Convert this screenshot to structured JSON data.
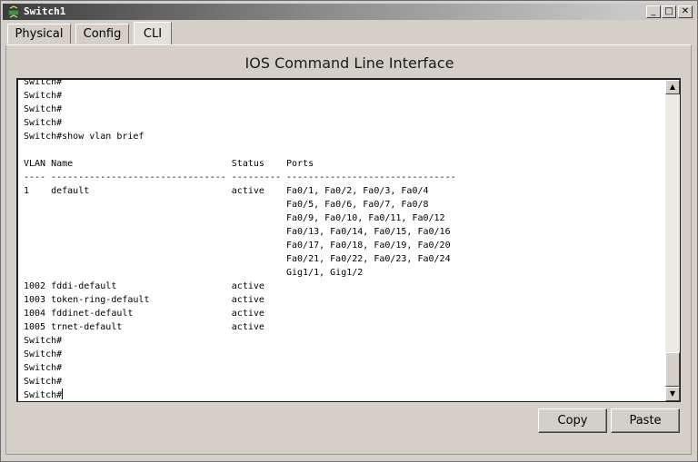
{
  "window": {
    "title": "Switch1",
    "min_glyph": "_",
    "max_glyph": "□",
    "close_glyph": "✕"
  },
  "tabs": [
    {
      "label": "Physical",
      "active": false
    },
    {
      "label": "Config",
      "active": false
    },
    {
      "label": "CLI",
      "active": true
    }
  ],
  "panel": {
    "title": "IOS Command Line Interface"
  },
  "console": {
    "lines": [
      "Switch#",
      "Switch#",
      "Switch#",
      "Switch#",
      "Switch#show vlan brief",
      "",
      "VLAN Name                             Status    Ports",
      "---- -------------------------------- --------- -------------------------------",
      "1    default                          active    Fa0/1, Fa0/2, Fa0/3, Fa0/4",
      "                                                Fa0/5, Fa0/6, Fa0/7, Fa0/8",
      "                                                Fa0/9, Fa0/10, Fa0/11, Fa0/12",
      "                                                Fa0/13, Fa0/14, Fa0/15, Fa0/16",
      "                                                Fa0/17, Fa0/18, Fa0/19, Fa0/20",
      "                                                Fa0/21, Fa0/22, Fa0/23, Fa0/24",
      "                                                Gig1/1, Gig1/2",
      "1002 fddi-default                     active",
      "1003 token-ring-default               active",
      "1004 fddinet-default                  active",
      "1005 trnet-default                    active",
      "Switch#",
      "Switch#",
      "Switch#",
      "Switch#"
    ],
    "prompt": "Switch#"
  },
  "scrollbar": {
    "up_glyph": "▲",
    "down_glyph": "▼"
  },
  "actions": {
    "copy_label": "Copy",
    "paste_label": "Paste"
  },
  "colors": {
    "titlebar_start": "#3c3c3c",
    "window_bg": "#d4d0c8",
    "console_bg": "#ffffff"
  }
}
